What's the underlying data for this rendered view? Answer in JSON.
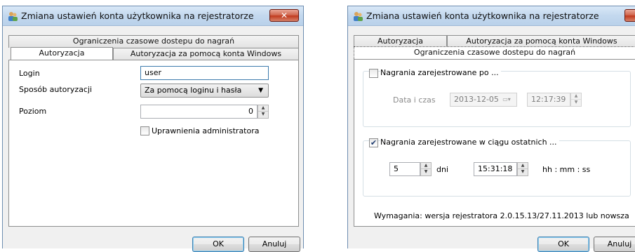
{
  "title": "Zmiana ustawień konta użytkownika na rejestratorze",
  "icons": {
    "app": "users-icon",
    "close": "close-icon"
  },
  "left": {
    "tabs": {
      "time_restrictions": "Ograniczenia czasowe dostepu do nagrań",
      "authorization": "Autoryzacja",
      "windows_auth": "Autoryzacja za pomocą konta Windows"
    },
    "login_label": "Login",
    "login_value": "user",
    "auth_method_label": "Sposób autoryzacji",
    "auth_method_value": "Za pomocą loginu i hasła",
    "level_label": "Poziom",
    "level_value": "0",
    "admin_label": "Uprawnienia administratora",
    "ok": "OK",
    "cancel": "Anuluj"
  },
  "right": {
    "tabs": {
      "authorization": "Autoryzacja",
      "windows_auth": "Autoryzacja za pomocą konta Windows",
      "time_restrictions": "Ograniczenia czasowe dostepu do nagrań"
    },
    "recorded_after_label": "Nagrania zarejestrowane po ...",
    "datetime_label": "Data i czas",
    "date_value": "2013-12-05",
    "time_value": "12:17:39",
    "recorded_within_label": "Nagrania zarejestrowane w ciągu ostatnich ...",
    "days_value": "5",
    "days_label": "dni",
    "duration_value": "15:31:18",
    "duration_format": "hh : mm : ss",
    "requirements": "Wymagania: wersja rejestratora 2.0.15.13/27.11.2013 lub nowsza",
    "ok": "OK",
    "cancel": "Anuluj"
  }
}
